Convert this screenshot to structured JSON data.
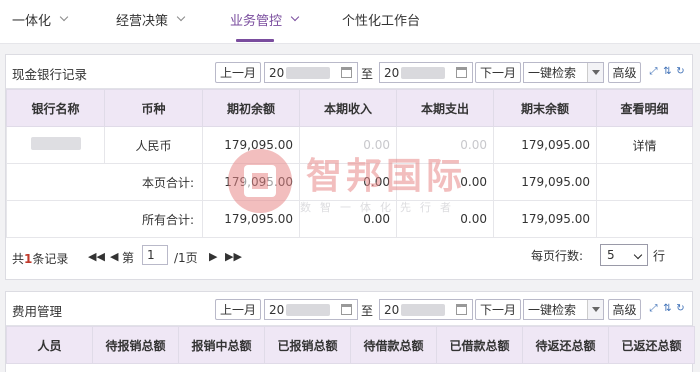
{
  "nav": {
    "items": [
      {
        "label": "一体化"
      },
      {
        "label": "经营决策"
      },
      {
        "label": "业务管控"
      },
      {
        "label": "个性化工作台"
      }
    ],
    "active_index": 2
  },
  "common": {
    "prev_month": "上一月",
    "to": "至",
    "next_month": "下一月",
    "one_key": "一键检索",
    "advanced": "高级",
    "date_prefix": "20",
    "date_prefix_2": "20"
  },
  "cash_panel": {
    "title": "现金银行记录",
    "headers": [
      "银行名称",
      "币种",
      "期初余额",
      "本期收入",
      "本期支出",
      "期末余额",
      "查看明细"
    ],
    "row": {
      "currency": "人民币",
      "opening": "179,095.00",
      "income": "0.00",
      "expense": "0.00",
      "closing": "179,095.00",
      "detail": "详情"
    },
    "page_total": {
      "label": "本页合计:",
      "opening": "179,095.00",
      "income": "0.00",
      "expense": "0.00",
      "closing": "179,095.00"
    },
    "all_total": {
      "label": "所有合计:",
      "opening": "179,095.00",
      "income": "0.00",
      "expense": "0.00",
      "closing": "179,095.00"
    },
    "pager": {
      "total_prefix": "共",
      "total_count": "1",
      "total_suffix": "条记录",
      "page_prefix": "第",
      "page_value": "1",
      "page_suffix": "/1页",
      "rows_label": "每页行数:",
      "rows_value": "5",
      "rows_unit": "行"
    }
  },
  "expense_panel": {
    "title": "费用管理",
    "date_prefix_2": "20",
    "headers": [
      "人员",
      "待报销总额",
      "报销中总额",
      "已报销总额",
      "待借款总额",
      "已借款总额",
      "待返还总额",
      "已返还总额"
    ]
  },
  "watermark": {
    "cn": "智邦国际",
    "sub": "数智一体化先行者"
  },
  "colors": {
    "accent": "#7a4d9e",
    "header_bg": "#efe7f5",
    "watermark": "#e88a8a"
  }
}
